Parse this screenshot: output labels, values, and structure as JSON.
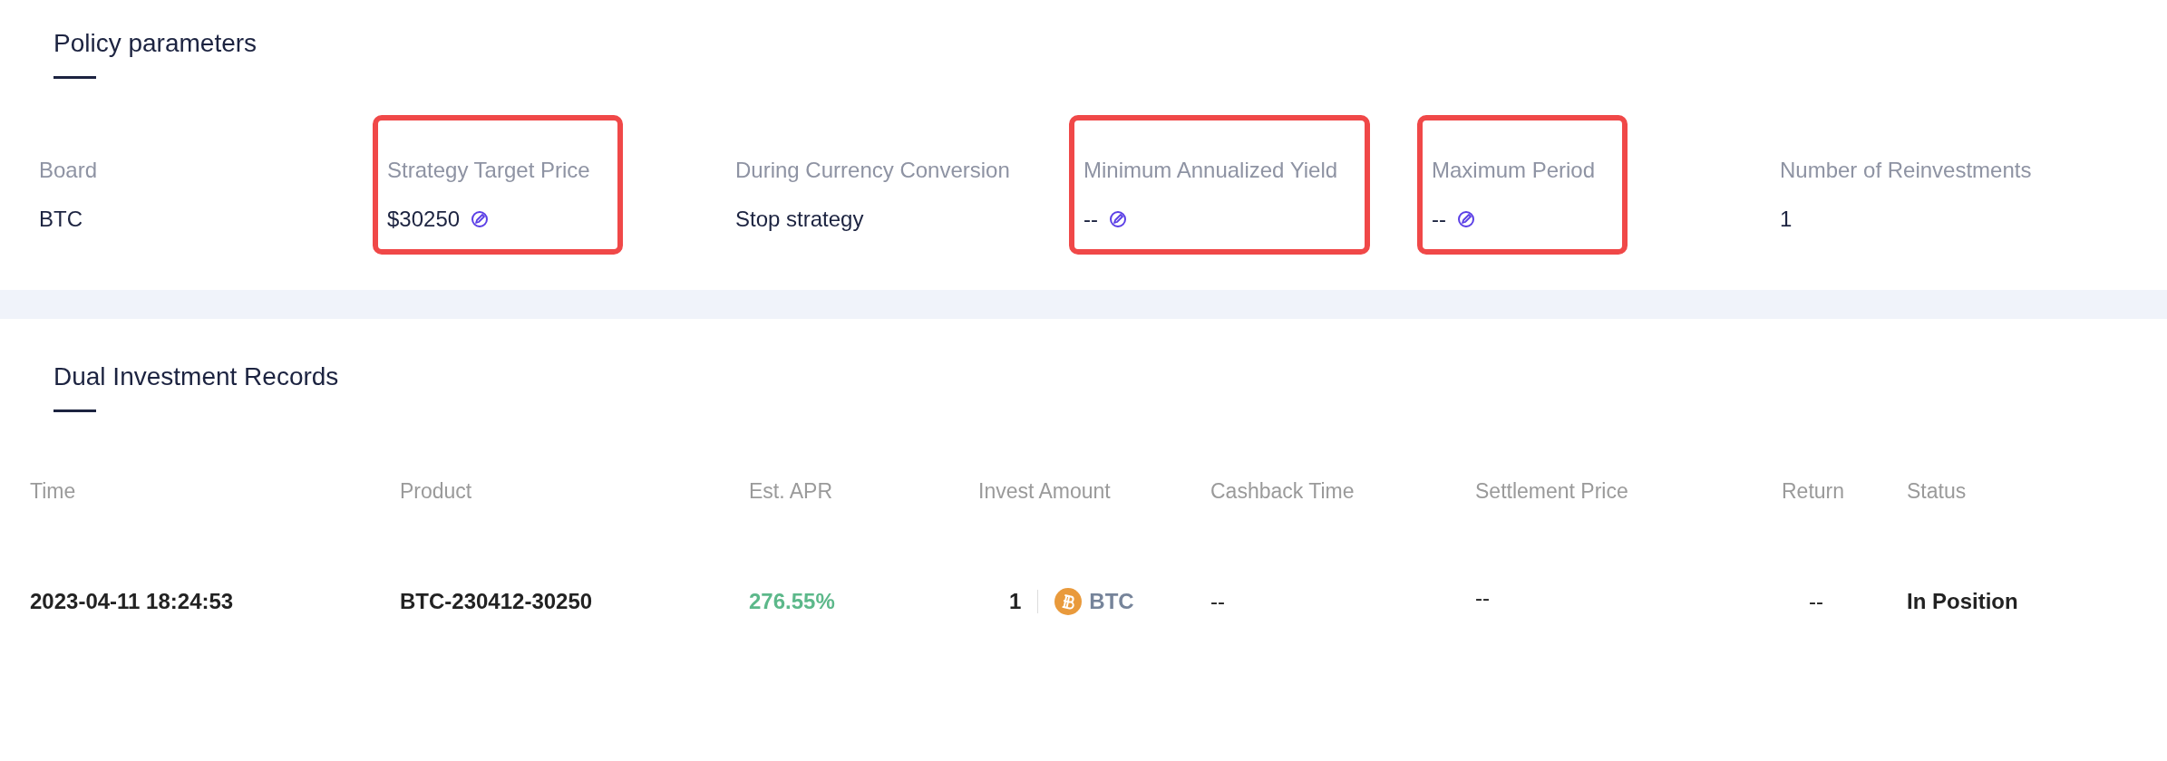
{
  "policy_parameters": {
    "title": "Policy parameters",
    "params": [
      {
        "label": "Board",
        "value": "BTC",
        "editable": false,
        "highlighted": false
      },
      {
        "label": "Strategy Target Price",
        "value": "$30250",
        "editable": true,
        "highlighted": true
      },
      {
        "label": "During Currency Conversion",
        "value": "Stop strategy",
        "editable": false,
        "highlighted": false
      },
      {
        "label": "Minimum Annualized Yield",
        "value": "--",
        "editable": true,
        "highlighted": true
      },
      {
        "label": "Maximum Period",
        "value": "--",
        "editable": true,
        "highlighted": true
      },
      {
        "label": "Number of Reinvestments",
        "value": "1",
        "editable": false,
        "highlighted": false
      }
    ]
  },
  "records": {
    "title": "Dual Investment Records",
    "columns": [
      "Time",
      "Product",
      "Est. APR",
      "Invest Amount",
      "Cashback Time",
      "Settlement Price",
      "Return",
      "Status"
    ],
    "rows": [
      {
        "time": "2023-04-11 18:24:53",
        "product": "BTC-230412-30250",
        "apr": "276.55%",
        "amount": "1",
        "currency": "BTC",
        "cashback_time": "--",
        "settlement_price": "--",
        "return": "--",
        "status": "In Position"
      }
    ]
  }
}
